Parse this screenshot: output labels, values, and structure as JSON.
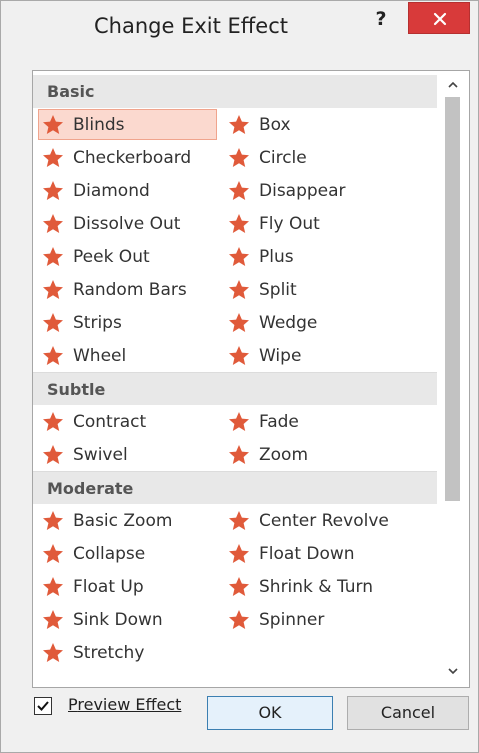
{
  "window": {
    "title": "Change Exit Effect",
    "help_label": "?",
    "close_label": "Close"
  },
  "list": {
    "groups": [
      {
        "name": "Basic",
        "items": [
          "Blinds",
          "Box",
          "Checkerboard",
          "Circle",
          "Diamond",
          "Disappear",
          "Dissolve Out",
          "Fly Out",
          "Peek Out",
          "Plus",
          "Random Bars",
          "Split",
          "Strips",
          "Wedge",
          "Wheel",
          "Wipe"
        ]
      },
      {
        "name": "Subtle",
        "items": [
          "Contract",
          "Fade",
          "Swivel",
          "Zoom"
        ]
      },
      {
        "name": "Moderate",
        "items": [
          "Basic Zoom",
          "Center Revolve",
          "Collapse",
          "Float Down",
          "Float Up",
          "Shrink & Turn",
          "Sink Down",
          "Spinner",
          "Stretchy"
        ]
      }
    ],
    "selected": "Blinds",
    "star_color": "#e05a3a"
  },
  "footer": {
    "preview_label_underlined": "P",
    "preview_label_rest": "review Effect",
    "preview_checked": true,
    "ok_label": "OK",
    "cancel_label": "Cancel"
  },
  "colors": {
    "close_button": "#d83a3a",
    "selection_fill": "#fbd9cf",
    "selection_border": "#f0a48d"
  }
}
